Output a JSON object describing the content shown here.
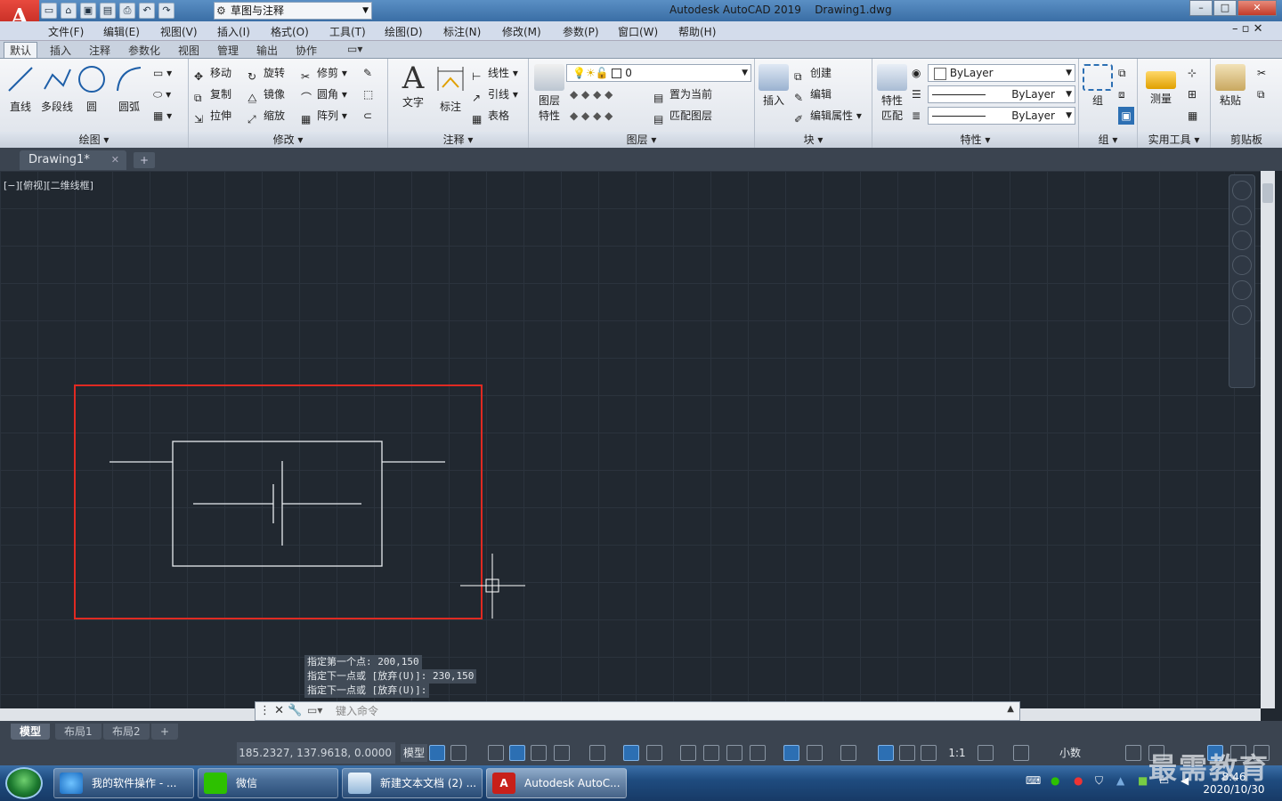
{
  "title_bar": {
    "app_title": "Autodesk AutoCAD 2019",
    "document_title": "Drawing1.dwg",
    "workspace": "草图与注释",
    "logo_letter": "A"
  },
  "menu": [
    "文件(F)",
    "编辑(E)",
    "视图(V)",
    "插入(I)",
    "格式(O)",
    "工具(T)",
    "绘图(D)",
    "标注(N)",
    "修改(M)",
    "参数(P)",
    "窗口(W)",
    "帮助(H)"
  ],
  "ribbon_tabs": [
    "默认",
    "插入",
    "注释",
    "参数化",
    "视图",
    "管理",
    "输出",
    "协作"
  ],
  "ribbon": {
    "draw": {
      "title": "绘图",
      "line": "直线",
      "polyline": "多段线",
      "circle": "圆",
      "arc": "圆弧"
    },
    "modify": {
      "title": "修改",
      "move": "移动",
      "rotate": "旋转",
      "trim": "修剪",
      "copy": "复制",
      "mirror": "镜像",
      "fillet": "圆角",
      "stretch": "拉伸",
      "scale": "缩放",
      "array": "阵列"
    },
    "annotation": {
      "title": "注释",
      "text": "文字",
      "dimension": "标注",
      "linear": "线性",
      "leader": "引线",
      "table": "表格"
    },
    "layers": {
      "title": "图层",
      "layer_props_1": "图层",
      "layer_props_2": "特性",
      "current_layer": "0",
      "set_current": "置为当前",
      "match_layer": "匹配图层"
    },
    "block": {
      "title": "块",
      "insert": "插入",
      "create": "创建",
      "edit": "编辑",
      "edit_attr": "编辑属性"
    },
    "properties": {
      "title": "特性",
      "match_1": "特性",
      "match_2": "匹配",
      "color": "ByLayer",
      "linetype": "ByLayer",
      "lineweight": "ByLayer"
    },
    "groups": {
      "title": "组",
      "group": "组"
    },
    "utilities": {
      "title": "实用工具",
      "measure": "测量"
    },
    "clipboard": {
      "title": "剪贴板",
      "paste": "粘贴"
    }
  },
  "doc_tab": {
    "name": "Drawing1*"
  },
  "viewport_label": "[−][俯视][二维线框]",
  "command_history": [
    "指定第一个点: 200,150",
    "指定下一点或 [放弃(U)]: 230,150",
    "指定下一点或 [放弃(U)]:"
  ],
  "command_placeholder": "键入命令",
  "layout_tabs": [
    "模型",
    "布局1",
    "布局2"
  ],
  "status": {
    "coords": "185.2327, 137.9618, 0.0000",
    "model": "模型",
    "scale": "1:1",
    "units": "小数"
  },
  "taskbar": {
    "items": [
      "我的软件操作 - ...",
      "微信",
      "新建文本文档 (2) ...",
      "Autodesk AutoC..."
    ],
    "clock_time": "8:46",
    "clock_date": "2020/10/30"
  },
  "watermark": "最需教育",
  "colors": {
    "canvas": "#212830",
    "selection_box": "#e02a22",
    "geometry": "#e8ecef",
    "accent": "#2c6fb3"
  }
}
